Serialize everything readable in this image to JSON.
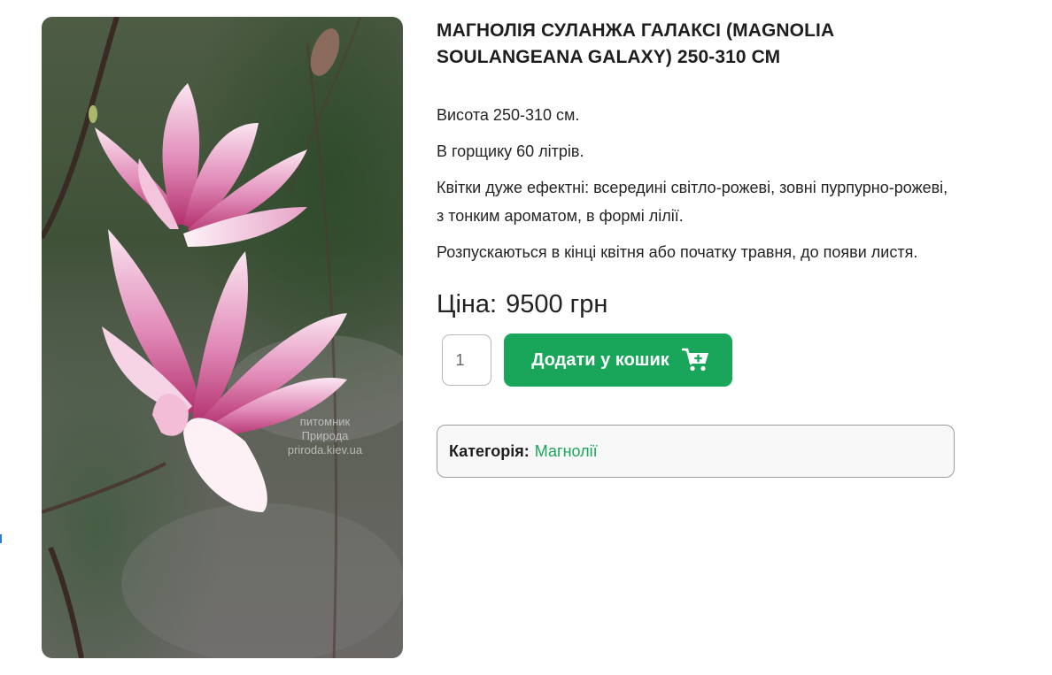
{
  "product": {
    "title": "МАГНОЛІЯ СУЛАНЖА ГАЛАКСІ (MAGNOLIA SOULANGEANA GALAXY) 250-310 СМ",
    "image_watermark": [
      "питомник",
      "Природа",
      "priroda.kiev.ua"
    ],
    "description": [
      "Висота 250-310 см.",
      "В горщику 60 літрів.",
      "Квітки дуже ефектні: всередині світло-рожеві, зовні пурпурно-рожеві, з тонким ароматом, в формі лілії.",
      "Розпускаються в кінці квітня або початку травня, до появи листя."
    ],
    "price_label": "Ціна:",
    "price_value": "9500 грн"
  },
  "cart": {
    "quantity": "1",
    "add_button_label": "Додати у кошик",
    "add_icon": "cart-plus-icon"
  },
  "meta": {
    "category_label": "Категорія:",
    "category_value": "Магнолії"
  },
  "colors": {
    "accent": "#1aa65a",
    "text": "#1e1e1e",
    "border": "#9c9c9c",
    "flower_pink": "#e89cc4"
  }
}
